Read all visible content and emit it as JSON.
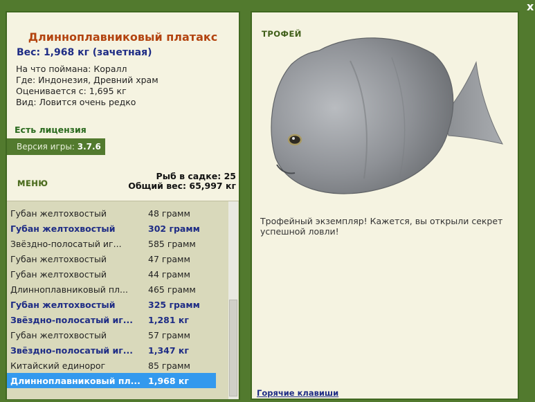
{
  "window": {
    "close_label": "x"
  },
  "catch": {
    "fish_name": "Длинноплавниковый платакс",
    "weight_line": "Вес: 1,968 кг (зачетная)",
    "bait_line": "На что поймана: Коралл",
    "where_line": "Где: Индонезия, Древний храм",
    "valued_line": "Оценивается с: 1,695 кг",
    "kind_line": "Вид: Ловится очень редко"
  },
  "license_label": "Есть лицензия",
  "version": {
    "label": "Версия игры:",
    "value": "3.7.6"
  },
  "menu_label": "МЕНЮ",
  "keepnet": {
    "fish_count_line": "Рыб в садке: 25",
    "total_weight_line": "Общий вес: 65,997 кг"
  },
  "fish_list": [
    {
      "name": "Губан желтохвостый",
      "weight": "48 грамм",
      "style": "normal"
    },
    {
      "name": "Губан желтохвостый",
      "weight": "302 грамм",
      "style": "bold"
    },
    {
      "name": "Звёздно-полосатый иг...",
      "weight": "585 грамм",
      "style": "normal"
    },
    {
      "name": "Губан желтохвостый",
      "weight": "47 грамм",
      "style": "normal"
    },
    {
      "name": "Губан желтохвостый",
      "weight": "44 грамм",
      "style": "normal"
    },
    {
      "name": "Длинноплавниковый пл...",
      "weight": "465 грамм",
      "style": "normal"
    },
    {
      "name": "Губан желтохвостый",
      "weight": "325 грамм",
      "style": "bold"
    },
    {
      "name": "Звёздно-полосатый иг...",
      "weight": "1,281 кг",
      "style": "bold"
    },
    {
      "name": "Губан желтохвостый",
      "weight": "57 грамм",
      "style": "normal"
    },
    {
      "name": "Звёздно-полосатый иг...",
      "weight": "1,347 кг",
      "style": "bold"
    },
    {
      "name": "Китайский единорог",
      "weight": "85 грамм",
      "style": "normal"
    },
    {
      "name": "Длинноплавниковый пл...",
      "weight": "1,968 кг",
      "style": "selected"
    }
  ],
  "trophy": {
    "heading": "ТРОФЕЙ",
    "fish_image": "platax-fish",
    "description": "Трофейный экземпляр! Кажется, вы открыли секрет успешной ловли!"
  },
  "hotkeys_label": "Горячие клавиши",
  "colors": {
    "frame_green": "#527a2e",
    "panel_bg": "#f5f3e1",
    "title_orange": "#b34410",
    "accent_blue": "#1e2c85",
    "selected_row": "#3399ee"
  }
}
